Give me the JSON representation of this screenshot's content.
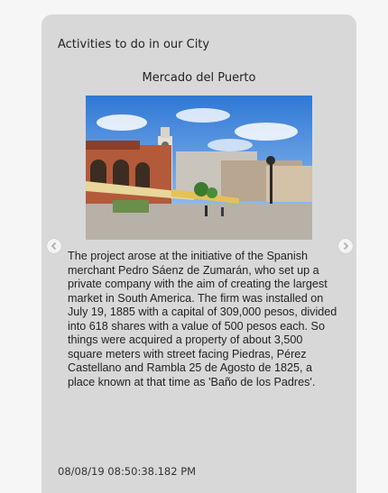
{
  "card": {
    "title": "Activities to do in our City"
  },
  "carousel": {
    "slide_title": "Mercado del Puerto",
    "description": "The project arose at the initiative of the Spanish merchant Pedro Sáenz de Zumarán, who set up a private company with the aim of creating the largest market in South America. The firm was installed on July 19, 1885 with a capital of 309,000 pesos, divided into 618 shares with a value of 500 pesos each. So things were acquired a property of about 3,500 square meters with street facing Piedras, Pérez Castellano and Rambla 25 de Agosto de 1825, a place known at that time as 'Baño de los Padres'.",
    "prev_icon": "chevron-left-icon",
    "next_icon": "chevron-right-icon"
  },
  "message": {
    "timestamp": "08/08/19 08:50:38.182 PM"
  },
  "colors": {
    "bubble": "#d8d8d8",
    "page": "#f6f6f6",
    "text": "#222222"
  }
}
